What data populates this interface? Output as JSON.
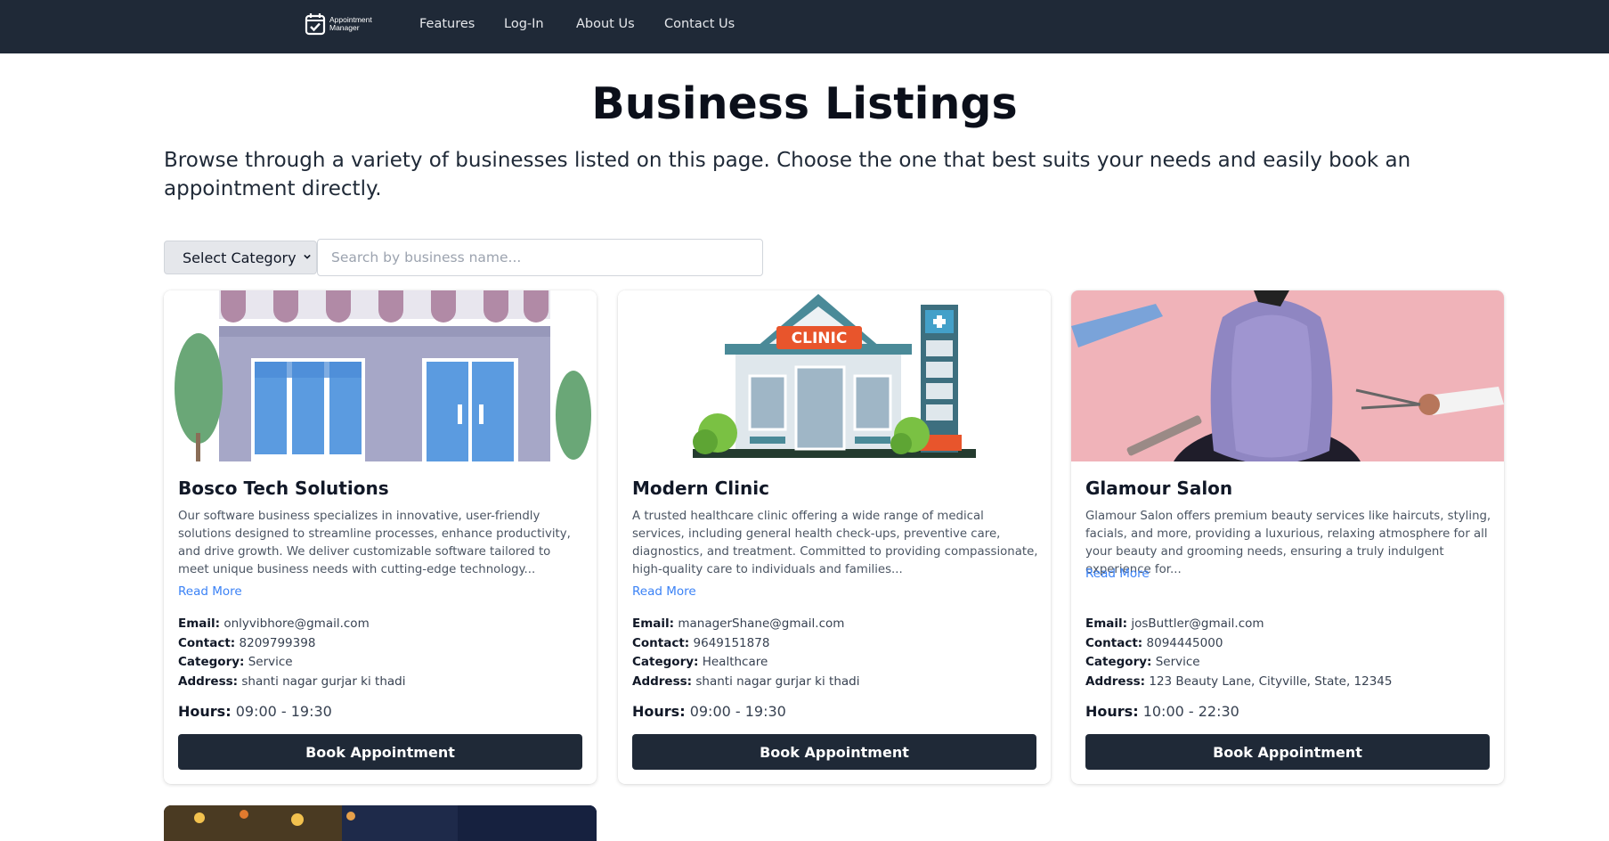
{
  "nav": {
    "logo_line1": "Appointment",
    "logo_line2": "Manager",
    "links": [
      "Features",
      "Log-In",
      "About Us",
      "Contact Us"
    ]
  },
  "header": {
    "title": "Business Listings",
    "description": "Browse through a variety of businesses listed on this page. Choose the one that best suits your needs and easily book an appointment directly."
  },
  "filters": {
    "category_selected": "Select Category",
    "search_placeholder": "Search by business name..."
  },
  "labels": {
    "email": "Email:",
    "contact": "Contact:",
    "category": "Category:",
    "address": "Address:",
    "hours": "Hours:",
    "read_more": "Read More",
    "book": "Book Appointment"
  },
  "cards": [
    {
      "name": "Bosco Tech Solutions",
      "description": "Our software business specializes in innovative, user-friendly solutions designed to streamline processes, enhance productivity, and drive growth. We deliver customizable software tailored to meet unique business needs with cutting-edge technology...",
      "email": "onlyvibhore@gmail.com",
      "contact": "8209799398",
      "category": "Service",
      "address": "shanti nagar gurjar ki thadi",
      "hours": "09:00 - 19:30"
    },
    {
      "name": "Modern Clinic",
      "description": "A trusted healthcare clinic offering a wide range of medical services, including general health check-ups, preventive care, diagnostics, and treatment. Committed to providing compassionate, high-quality care to individuals and families...",
      "email": "managerShane@gmail.com",
      "contact": "9649151878",
      "category": "Healthcare",
      "address": "shanti nagar gurjar ki thadi",
      "hours": "09:00 - 19:30",
      "sign": "CLINIC"
    },
    {
      "name": "Glamour Salon",
      "description": "Glamour Salon offers premium beauty services like haircuts, styling, facials, and more, providing a luxurious, relaxing atmosphere for all your beauty and grooming needs, ensuring a truly indulgent experience for...",
      "email": "josButtler@gmail.com",
      "contact": "8094445000",
      "category": "Service",
      "address": "123 Beauty Lane, Cityville, State, 12345",
      "hours": "10:00 - 22:30"
    }
  ]
}
